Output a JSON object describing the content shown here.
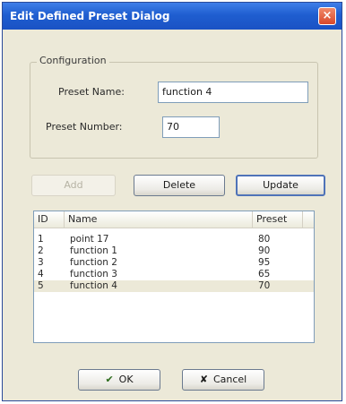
{
  "window": {
    "title": "Edit Defined Preset Dialog",
    "close_symbol": "×"
  },
  "configuration": {
    "group_label": "Configuration",
    "preset_name_label": "Preset Name:",
    "preset_name_value": "function 4",
    "preset_number_label": "Preset Number:",
    "preset_number_value": "70"
  },
  "actions": {
    "add_label": "Add",
    "delete_label": "Delete",
    "update_label": "Update"
  },
  "list": {
    "columns": [
      "ID",
      "Name",
      "Preset"
    ],
    "rows": [
      {
        "id": "1",
        "name": "point 17",
        "preset": "80"
      },
      {
        "id": "2",
        "name": "function 1",
        "preset": "90"
      },
      {
        "id": "3",
        "name": "function 2",
        "preset": "95"
      },
      {
        "id": "4",
        "name": "function 3",
        "preset": "65"
      },
      {
        "id": "5",
        "name": "function 4",
        "preset": "70"
      }
    ],
    "selected_row": "5"
  },
  "footer": {
    "ok_label": "OK",
    "cancel_label": "Cancel",
    "ok_icon": "checkmark-icon",
    "cancel_icon": "x-icon"
  }
}
